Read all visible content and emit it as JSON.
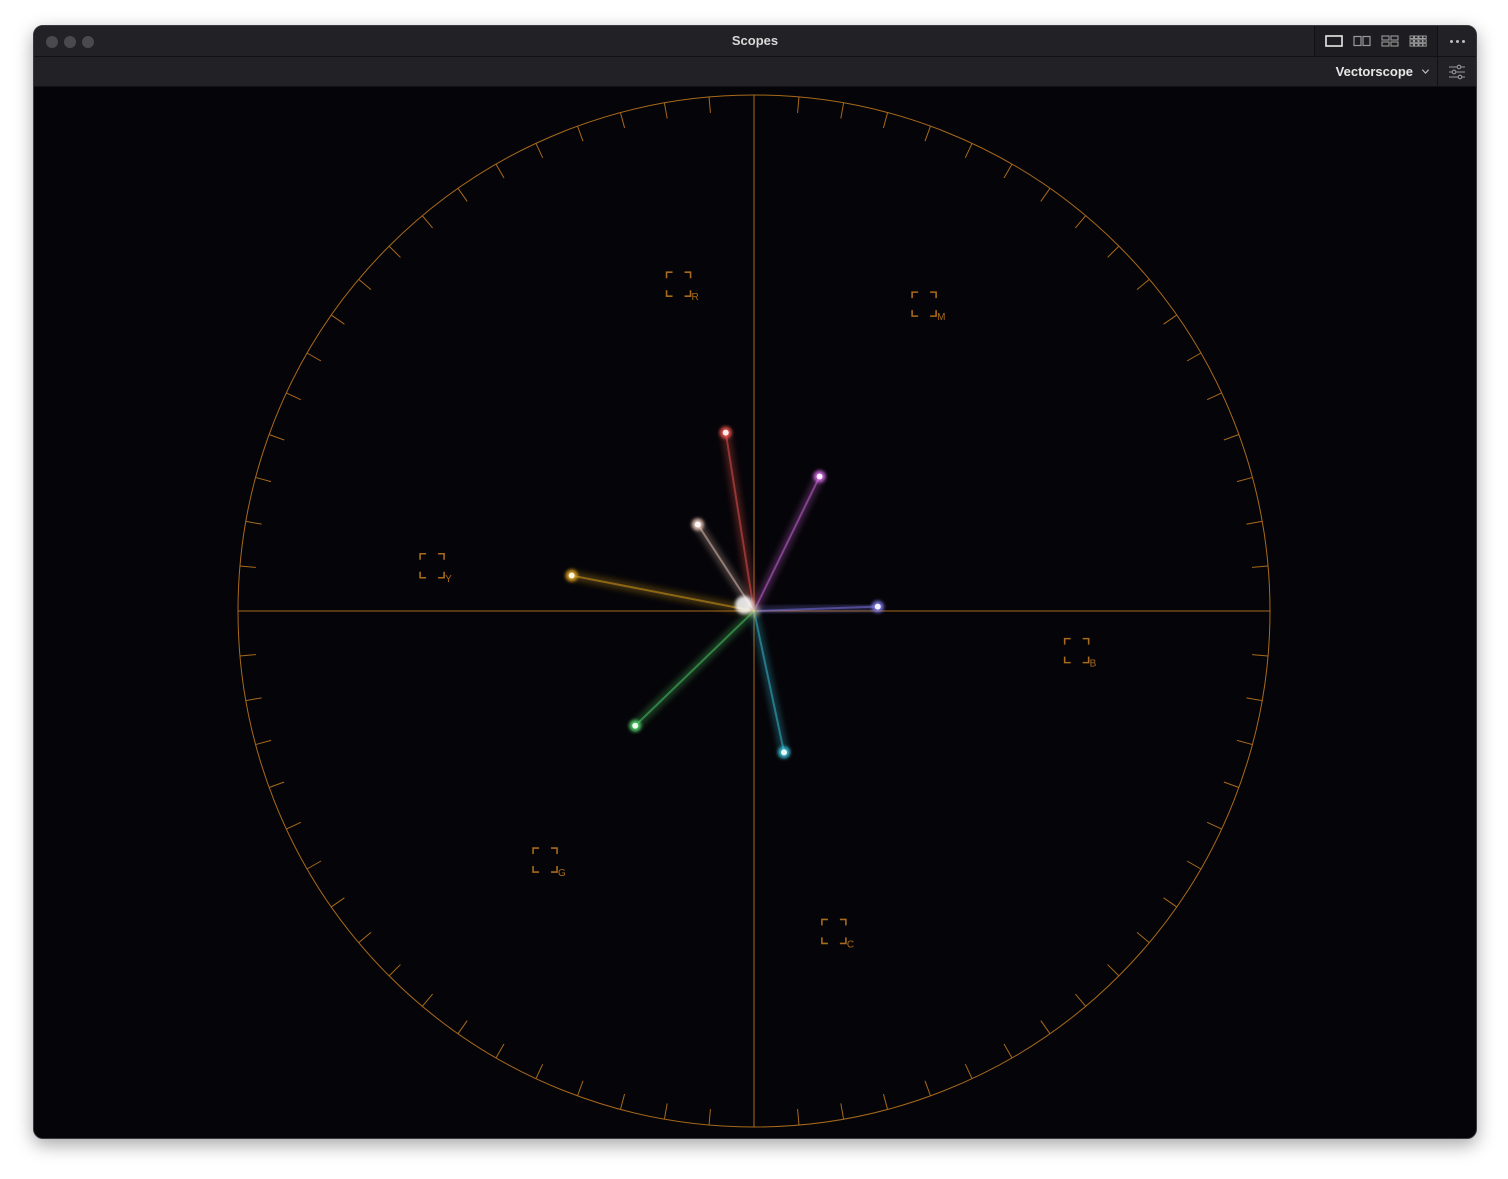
{
  "window": {
    "title": "Scopes"
  },
  "toolbar": {
    "scope_type": "Vectorscope",
    "layout_buttons": [
      "single-layout-icon",
      "dual-layout-icon",
      "quad-layout-icon",
      "grid-layout-icon"
    ],
    "more_icon": "more-options-icon",
    "settings_icon": "scope-settings-icon"
  },
  "vectorscope": {
    "graticule_color": "#a86a1c",
    "targets": [
      {
        "id": "R",
        "label": "R",
        "angle_deg": 103,
        "radius": 0.65
      },
      {
        "id": "M",
        "label": "M",
        "angle_deg": 61,
        "radius": 0.68
      },
      {
        "id": "B",
        "label": "B",
        "angle_deg": -7,
        "radius": 0.63
      },
      {
        "id": "C",
        "label": "C",
        "angle_deg": -76,
        "radius": 0.64
      },
      {
        "id": "G",
        "label": "G",
        "angle_deg": -130,
        "radius": 0.63
      },
      {
        "id": "Y",
        "label": "Y",
        "angle_deg": 172,
        "radius": 0.63
      }
    ],
    "traces": [
      {
        "name": "red",
        "color": "#ff5a52",
        "angle_deg": 99,
        "radius": 0.35
      },
      {
        "name": "magenta",
        "color": "#e070f0",
        "angle_deg": 64,
        "radius": 0.29
      },
      {
        "name": "blue",
        "color": "#8a82ff",
        "angle_deg": 2,
        "radius": 0.24
      },
      {
        "name": "cyan",
        "color": "#40d0e8",
        "angle_deg": -78,
        "radius": 0.28
      },
      {
        "name": "green",
        "color": "#55e070",
        "angle_deg": -136,
        "radius": 0.32
      },
      {
        "name": "yellow",
        "color": "#f0b020",
        "angle_deg": 169,
        "radius": 0.36
      },
      {
        "name": "skin",
        "color": "#ffd8c8",
        "angle_deg": 123,
        "radius": 0.2
      }
    ]
  }
}
